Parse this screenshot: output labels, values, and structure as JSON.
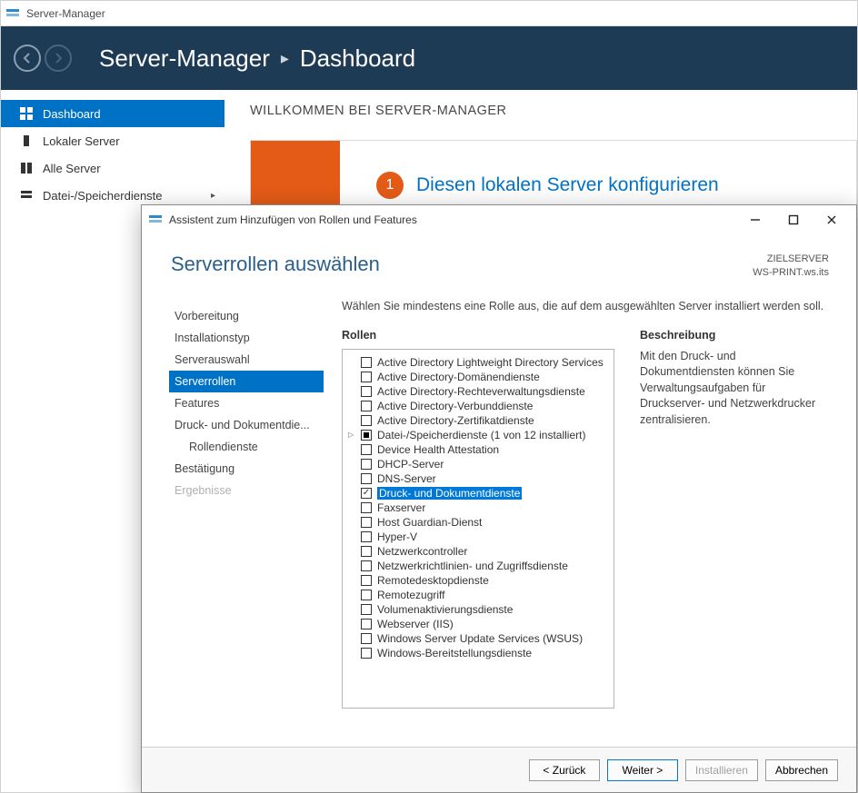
{
  "main": {
    "title": "Server-Manager",
    "breadcrumb": {
      "app": "Server-Manager",
      "page": "Dashboard"
    },
    "sidebar": [
      {
        "label": "Dashboard",
        "icon": "dashboard",
        "selected": true
      },
      {
        "label": "Lokaler Server",
        "icon": "server"
      },
      {
        "label": "Alle Server",
        "icon": "servers"
      },
      {
        "label": "Datei-/Speicherdienste",
        "icon": "storage",
        "expandable": true
      }
    ],
    "welcome_hdr": "WILLKOMMEN BEI SERVER-MANAGER",
    "step1_num": "1",
    "step1_text": "Diesen lokalen Server konfigurieren"
  },
  "wizard": {
    "title": "Assistent zum Hinzufügen von Rollen und Features",
    "heading": "Serverrollen auswählen",
    "target_lbl": "ZIELSERVER",
    "target_val": "WS-PRINT.ws.its",
    "steps": [
      {
        "label": "Vorbereitung"
      },
      {
        "label": "Installationstyp"
      },
      {
        "label": "Serverauswahl"
      },
      {
        "label": "Serverrollen",
        "selected": true
      },
      {
        "label": "Features"
      },
      {
        "label": "Druck- und Dokumentdie..."
      },
      {
        "label": "Rollendienste",
        "sub": true
      },
      {
        "label": "Bestätigung"
      },
      {
        "label": "Ergebnisse",
        "disabled": true
      }
    ],
    "instr": "Wählen Sie mindestens eine Rolle aus, die auf dem ausgewählten Server installiert werden soll.",
    "roles_hdr": "Rollen",
    "desc_hdr": "Beschreibung",
    "desc_text": "Mit den Druck- und Dokumentdiensten können Sie Verwaltungsaufgaben für Druckserver- und Netzwerkdrucker zentralisieren.",
    "roles": [
      {
        "label": "Active Directory Lightweight Directory Services"
      },
      {
        "label": "Active Directory-Domänendienste"
      },
      {
        "label": "Active Directory-Rechteverwaltungsdienste"
      },
      {
        "label": "Active Directory-Verbunddienste"
      },
      {
        "label": "Active Directory-Zertifikatdienste"
      },
      {
        "label": "Datei-/Speicherdienste (1 von 12 installiert)",
        "partial": true,
        "tree": true
      },
      {
        "label": "Device Health Attestation"
      },
      {
        "label": "DHCP-Server"
      },
      {
        "label": "DNS-Server"
      },
      {
        "label": "Druck- und Dokumentdienste",
        "checked": true,
        "selected": true
      },
      {
        "label": "Faxserver"
      },
      {
        "label": "Host Guardian-Dienst"
      },
      {
        "label": "Hyper-V"
      },
      {
        "label": "Netzwerkcontroller"
      },
      {
        "label": "Netzwerkrichtlinien- und Zugriffsdienste"
      },
      {
        "label": "Remotedesktopdienste"
      },
      {
        "label": "Remotezugriff"
      },
      {
        "label": "Volumenaktivierungsdienste"
      },
      {
        "label": "Webserver (IIS)"
      },
      {
        "label": "Windows Server Update Services (WSUS)"
      },
      {
        "label": "Windows-Bereitstellungsdienste"
      }
    ],
    "buttons": {
      "back": "< Zurück",
      "next": "Weiter >",
      "install": "Installieren",
      "cancel": "Abbrechen"
    }
  }
}
